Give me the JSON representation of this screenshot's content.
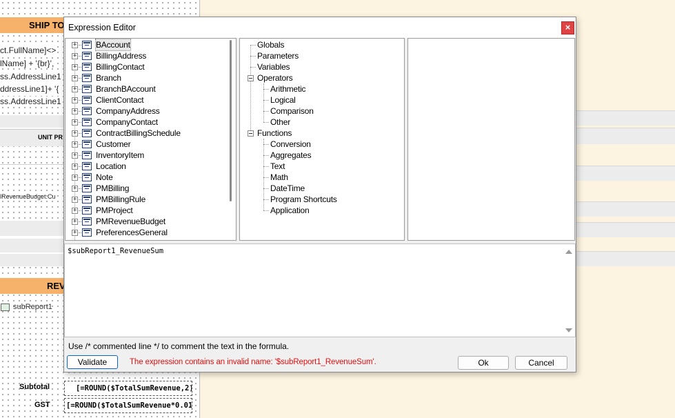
{
  "background": {
    "ship_header": "SHIP TO",
    "field_lines": [
      "ct.FullName]<>",
      "lName] + '{br}',",
      "ss.AddressLine1",
      "ddressLine1]+ '{",
      "ss.AddressLine1"
    ],
    "unit_price_header": "UNIT PR",
    "budget_field": "lRevenueBudget.Cu",
    "revenue_header": "REV",
    "subreport_label": "subReport1",
    "subtotal_label": "Subtotal",
    "subtotal_formula": "[=ROUND($TotalSumRevenue,2)]",
    "gst_label": "GST",
    "gst_formula": "[=ROUND($TotalSumRevenue*0.01,"
  },
  "dialog": {
    "title": "Expression Editor",
    "close_glyph": "×",
    "tables": [
      "BAccount",
      "BillingAddress",
      "BillingContact",
      "Branch",
      "BranchBAccount",
      "ClientContact",
      "CompanyAddress",
      "CompanyContact",
      "ContractBillingSchedule",
      "Customer",
      "InventoryItem",
      "Location",
      "Note",
      "PMBilling",
      "PMBillingRule",
      "PMProject",
      "PMRevenueBudget",
      "PreferencesGeneral"
    ],
    "categories": {
      "globals": "Globals",
      "parameters": "Parameters",
      "variables": "Variables",
      "operators": "Operators",
      "operator_items": [
        "Arithmetic",
        "Logical",
        "Comparison",
        "Other"
      ],
      "functions": "Functions",
      "function_items": [
        "Conversion",
        "Aggregates",
        "Text",
        "Math",
        "DateTime",
        "Program Shortcuts",
        "Application"
      ]
    },
    "expression": "$subReport1_RevenueSum",
    "hint": "Use /* commented line */ to comment the text in the formula.",
    "validate_label": "Validate",
    "error_message": "The expression contains an invalid name: '$subReport1_RevenueSum'.",
    "ok_label": "Ok",
    "cancel_label": "Cancel"
  },
  "colors": {
    "band_orange": "#f6b26b",
    "canvas_right": "#fcf3e0",
    "close_red": "#e04343",
    "error_red": "#e01010",
    "icon_blue": "#1c3a8f"
  }
}
